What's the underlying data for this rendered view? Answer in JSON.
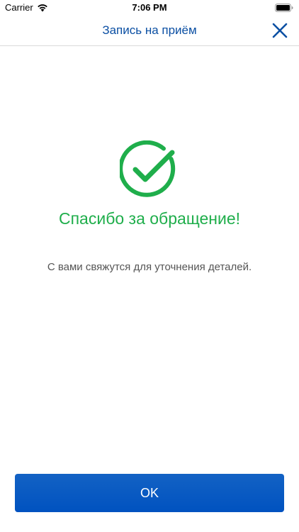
{
  "status_bar": {
    "carrier": "Carrier",
    "time": "7:06 PM",
    "wifi_icon": "wifi-icon",
    "battery_icon": "battery-icon"
  },
  "header": {
    "title": "Запись на приём",
    "close_icon": "close-icon"
  },
  "content": {
    "icon": "checkmark-circle-icon",
    "heading": "Спасибо за обращение!",
    "message": "С вами свяжутся для уточнения деталей."
  },
  "actions": {
    "ok_label": "OK"
  },
  "colors": {
    "accent": "#0b4fa3",
    "success": "#1fae4b",
    "button": "#0052c0",
    "message_text": "#555555"
  }
}
